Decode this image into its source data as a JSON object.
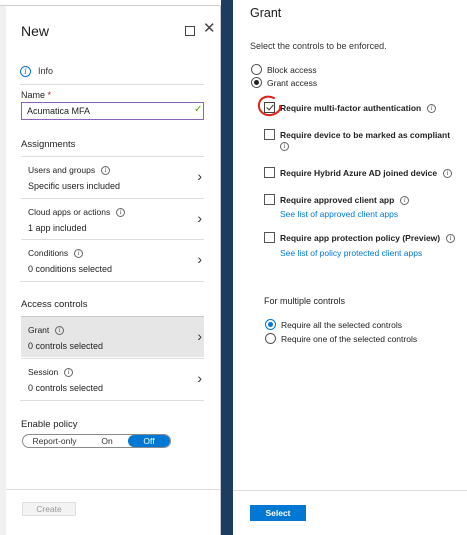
{
  "left_blade": {
    "title": "New",
    "info_label": "Info",
    "name_label": "Name",
    "name_required_mark": "*",
    "name_value": "Acumatica MFA",
    "assignments_label": "Assignments",
    "users_and_groups": {
      "label": "Users and groups",
      "value": "Specific users included"
    },
    "cloud_apps": {
      "label": "Cloud apps or actions",
      "value": "1 app included"
    },
    "conditions": {
      "label": "Conditions",
      "value": "0 conditions selected"
    },
    "access_controls_label": "Access controls",
    "grant": {
      "label": "Grant",
      "value": "0 controls selected"
    },
    "session": {
      "label": "Session",
      "value": "0 controls selected"
    },
    "enable_policy_label": "Enable policy",
    "toggle": {
      "options": [
        "Report-only",
        "On",
        "Off"
      ],
      "selected": "Off"
    },
    "create_label": "Create"
  },
  "right_blade": {
    "title": "Grant",
    "subtitle": "Select the controls to be enforced.",
    "access_options": [
      {
        "label": "Block access",
        "checked": false
      },
      {
        "label": "Grant access",
        "checked": true
      }
    ],
    "controls": [
      {
        "label": "Require multi-factor authentication",
        "checked": true
      },
      {
        "label": "Require device to be marked as compliant",
        "checked": false
      },
      {
        "label": "Require Hybrid Azure AD joined device",
        "checked": false
      },
      {
        "label": "Require approved client app",
        "link": "See list of approved client apps",
        "checked": false
      },
      {
        "label": "Require app protection policy (Preview)",
        "link": "See list of policy protected client apps",
        "checked": false
      }
    ],
    "multiple_controls_label": "For multiple controls",
    "multiple_options": [
      {
        "label": "Require all the selected controls",
        "checked": true
      },
      {
        "label": "Require one of the selected controls",
        "checked": false
      }
    ],
    "select_label": "Select"
  },
  "colors": {
    "accent": "#0078d4",
    "annotation": "#e0201b",
    "background": "#1b3a5f"
  }
}
